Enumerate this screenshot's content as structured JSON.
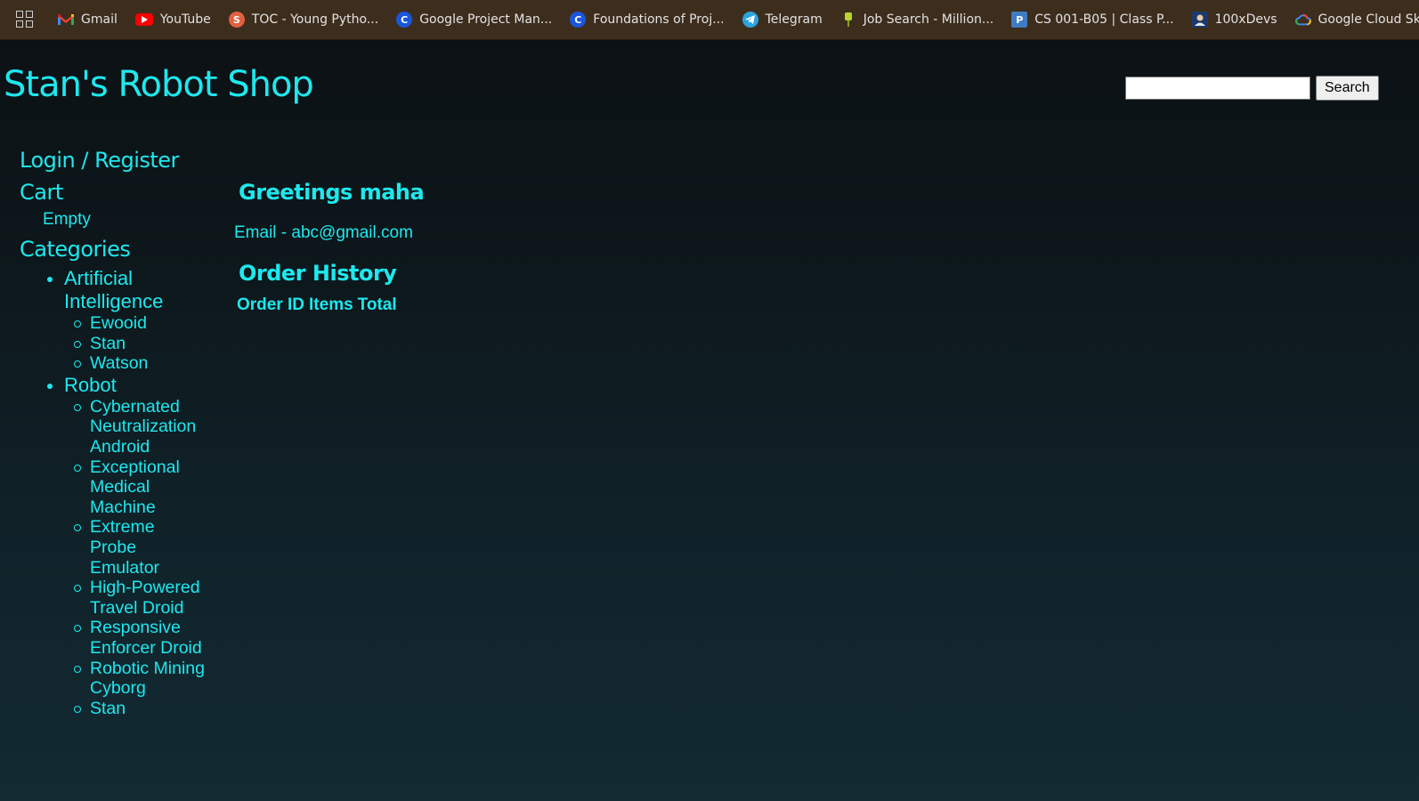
{
  "bookmarks": [
    {
      "label": "Gmail",
      "icon": "gmail-icon"
    },
    {
      "label": "YouTube",
      "icon": "youtube-icon"
    },
    {
      "label": "TOC - Young Pytho...",
      "icon": "toc-icon"
    },
    {
      "label": "Google Project Man...",
      "icon": "coursera-icon"
    },
    {
      "label": "Foundations of Proj...",
      "icon": "coursera-icon"
    },
    {
      "label": "Telegram",
      "icon": "telegram-icon"
    },
    {
      "label": "Job Search - Million...",
      "icon": "job-icon"
    },
    {
      "label": "CS 001-B05 | Class P...",
      "icon": "piazza-icon"
    },
    {
      "label": "100xDevs",
      "icon": "devs-icon"
    },
    {
      "label": "Google Cloud Skil",
      "icon": "gcloud-icon"
    }
  ],
  "header": {
    "title": "Stan's Robot Shop",
    "search_placeholder": "",
    "search_button": "Search"
  },
  "sidebar": {
    "login": "Login / Register",
    "cart_heading": "Cart",
    "cart_status": "Empty",
    "categories_heading": "Categories",
    "categories": [
      {
        "name": "Artificial Intelligence",
        "items": [
          "Ewooid",
          "Stan",
          "Watson"
        ]
      },
      {
        "name": "Robot",
        "items": [
          "Cybernated Neutralization Android",
          "Exceptional Medical Machine",
          "Extreme Probe Emulator",
          "High-Powered Travel Droid",
          "Responsive Enforcer Droid",
          "Robotic Mining Cyborg",
          "Stan"
        ]
      }
    ]
  },
  "main": {
    "greeting": "Greetings maha",
    "email": "Email - abc@gmail.com",
    "order_history_heading": "Order History",
    "order_columns": [
      "Order ID",
      "Items",
      "Total"
    ]
  },
  "colors": {
    "accent": "#1ee8ee",
    "bookmarks_bar": "#3d2d1d"
  }
}
